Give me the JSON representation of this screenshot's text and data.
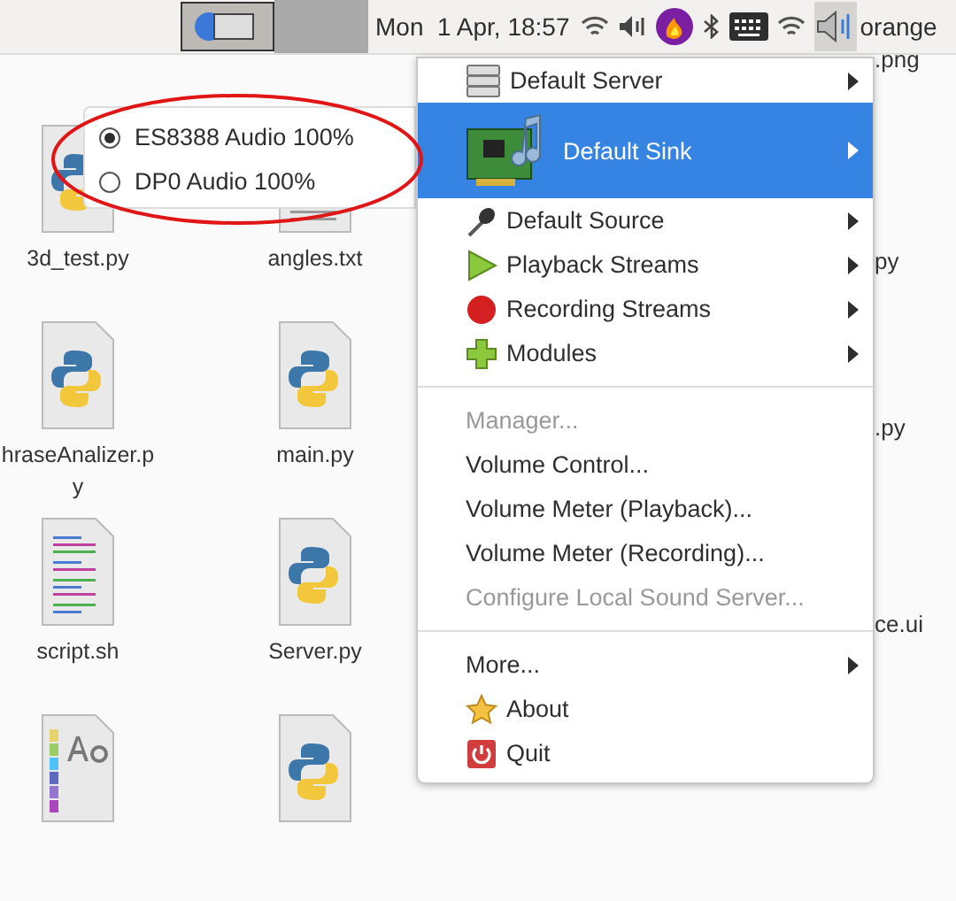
{
  "top_panel": {
    "clock": "Mon  1 Apr, 18:57",
    "user": "orange"
  },
  "files": [
    {
      "name": "3d_test.py",
      "kind": "python"
    },
    {
      "name": "angles.txt",
      "kind": "text"
    },
    {
      "name": "hraseAnalizer.py",
      "kind": "python"
    },
    {
      "name": "main.py",
      "kind": "python"
    },
    {
      "name": "script.sh",
      "kind": "script"
    },
    {
      "name": "Server.py",
      "kind": "python"
    },
    {
      "kind": "font"
    },
    {
      "kind": "python"
    }
  ],
  "right_column_fragments": [
    ".png",
    "py",
    ".py",
    "ce.ui"
  ],
  "sink_submenu": [
    {
      "label": "ES8388 Audio 100%",
      "selected": true
    },
    {
      "label": "DP0 Audio 100%",
      "selected": false
    }
  ],
  "menu": [
    {
      "kind": "item",
      "label": "Default Server",
      "submenu": true,
      "disabled": false,
      "highlighted": false
    },
    {
      "kind": "item",
      "label": "Default Sink",
      "submenu": true,
      "disabled": false,
      "highlighted": true
    },
    {
      "kind": "item",
      "label": "Default Source",
      "submenu": true,
      "disabled": false,
      "highlighted": false
    },
    {
      "kind": "item",
      "label": "Playback Streams",
      "submenu": true,
      "disabled": false,
      "highlighted": false
    },
    {
      "kind": "item",
      "label": "Recording Streams",
      "submenu": true,
      "disabled": false,
      "highlighted": false
    },
    {
      "kind": "item",
      "label": "Modules",
      "submenu": true,
      "disabled": false,
      "highlighted": false
    },
    {
      "kind": "separator"
    },
    {
      "kind": "item",
      "label": "Manager...",
      "submenu": false,
      "disabled": true,
      "highlighted": false
    },
    {
      "kind": "item",
      "label": "Volume Control...",
      "submenu": false,
      "disabled": false,
      "highlighted": false
    },
    {
      "kind": "item",
      "label": "Volume Meter (Playback)...",
      "submenu": false,
      "disabled": false,
      "highlighted": false
    },
    {
      "kind": "item",
      "label": "Volume Meter (Recording)...",
      "submenu": false,
      "disabled": false,
      "highlighted": false
    },
    {
      "kind": "item",
      "label": "Configure Local Sound Server...",
      "submenu": false,
      "disabled": true,
      "highlighted": false
    },
    {
      "kind": "separator"
    },
    {
      "kind": "item",
      "label": "More...",
      "submenu": true,
      "disabled": false,
      "highlighted": false
    },
    {
      "kind": "item",
      "label": "About",
      "submenu": false,
      "disabled": false,
      "highlighted": false
    },
    {
      "kind": "item",
      "label": "Quit",
      "submenu": false,
      "disabled": false,
      "highlighted": false
    }
  ]
}
